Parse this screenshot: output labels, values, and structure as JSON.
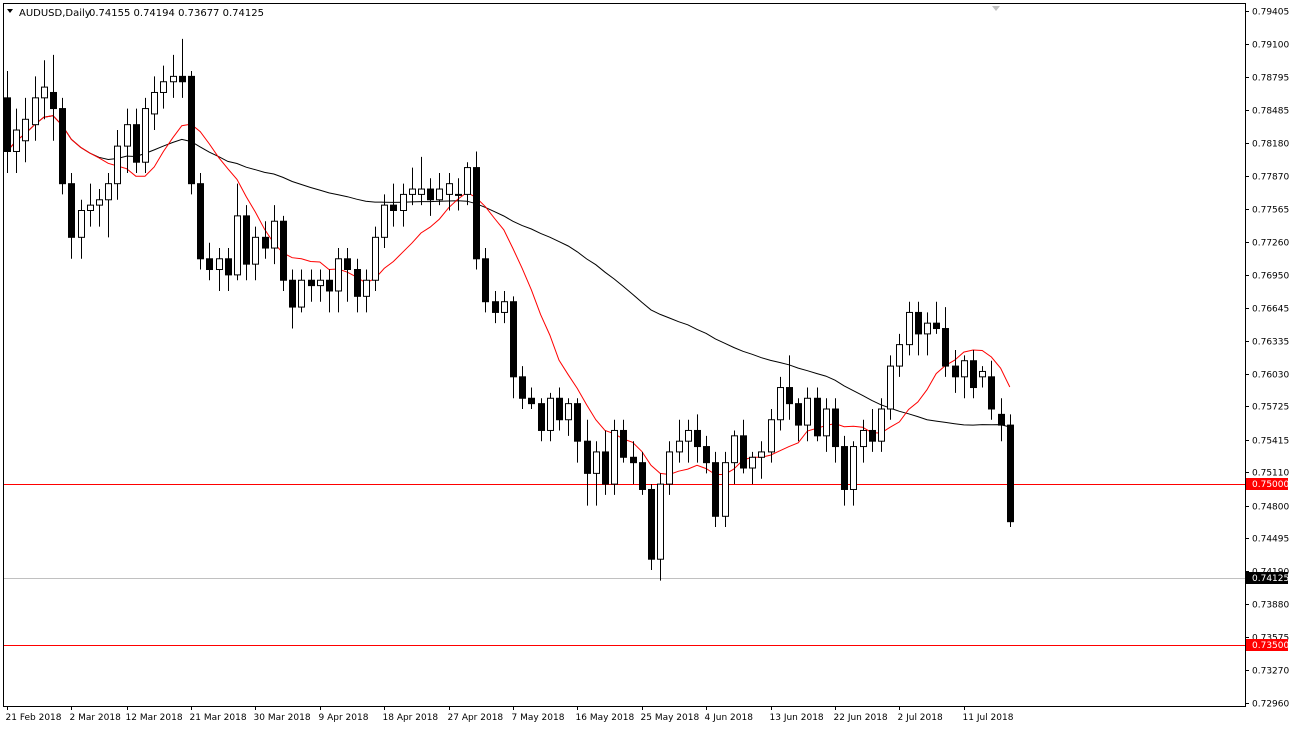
{
  "header": {
    "symbol": "AUDUSD,Daily",
    "ohlc": "0.74155 0.74194 0.73677 0.74125"
  },
  "chart_data": {
    "type": "candlestick",
    "symbol": "AUDUSD",
    "timeframe": "Daily",
    "ylim": [
      0.7296,
      0.794
    ],
    "y_ticks": [
      "0.79405",
      "0.79100",
      "0.78795",
      "0.78485",
      "0.78180",
      "0.77870",
      "0.77565",
      "0.77260",
      "0.76950",
      "0.76645",
      "0.76335",
      "0.76030",
      "0.75725",
      "0.75415",
      "0.75110",
      "0.74800",
      "0.74495",
      "0.74190",
      "0.73880",
      "0.73575",
      "0.73270",
      "0.72960"
    ],
    "x_ticks": [
      {
        "label": "21 Feb 2018",
        "index": 0
      },
      {
        "label": "2 Mar 2018",
        "index": 7
      },
      {
        "label": "12 Mar 2018",
        "index": 13
      },
      {
        "label": "21 Mar 2018",
        "index": 20
      },
      {
        "label": "30 Mar 2018",
        "index": 27
      },
      {
        "label": "9 Apr 2018",
        "index": 34
      },
      {
        "label": "18 Apr 2018",
        "index": 41
      },
      {
        "label": "27 Apr 2018",
        "index": 48
      },
      {
        "label": "7 May 2018",
        "index": 55
      },
      {
        "label": "16 May 2018",
        "index": 62
      },
      {
        "label": "25 May 2018",
        "index": 69
      },
      {
        "label": "4 Jun 2018",
        "index": 76
      },
      {
        "label": "13 Jun 2018",
        "index": 83
      },
      {
        "label": "22 Jun 2018",
        "index": 90
      },
      {
        "label": "2 Jul 2018",
        "index": 97
      },
      {
        "label": "11 Jul 2018",
        "index": 104
      }
    ],
    "candles": [
      [
        0.786,
        0.7885,
        0.779,
        0.781
      ],
      [
        0.781,
        0.785,
        0.779,
        0.783
      ],
      [
        0.782,
        0.786,
        0.78,
        0.784
      ],
      [
        0.7835,
        0.788,
        0.782,
        0.786
      ],
      [
        0.786,
        0.7895,
        0.784,
        0.787
      ],
      [
        0.7865,
        0.79,
        0.782,
        0.785
      ],
      [
        0.785,
        0.786,
        0.777,
        0.778
      ],
      [
        0.778,
        0.779,
        0.771,
        0.773
      ],
      [
        0.773,
        0.7765,
        0.771,
        0.7755
      ],
      [
        0.7755,
        0.778,
        0.774,
        0.776
      ],
      [
        0.776,
        0.7775,
        0.774,
        0.7765
      ],
      [
        0.7765,
        0.779,
        0.773,
        0.778
      ],
      [
        0.778,
        0.783,
        0.7765,
        0.7815
      ],
      [
        0.7815,
        0.785,
        0.779,
        0.7835
      ],
      [
        0.7835,
        0.785,
        0.779,
        0.78
      ],
      [
        0.78,
        0.786,
        0.779,
        0.785
      ],
      [
        0.7845,
        0.788,
        0.783,
        0.7865
      ],
      [
        0.7865,
        0.789,
        0.785,
        0.7875
      ],
      [
        0.7875,
        0.79,
        0.786,
        0.788
      ],
      [
        0.788,
        0.7915,
        0.786,
        0.7875
      ],
      [
        0.788,
        0.7885,
        0.777,
        0.778
      ],
      [
        0.778,
        0.779,
        0.77,
        0.771
      ],
      [
        0.771,
        0.7725,
        0.769,
        0.77
      ],
      [
        0.77,
        0.772,
        0.768,
        0.771
      ],
      [
        0.771,
        0.772,
        0.768,
        0.7695
      ],
      [
        0.7695,
        0.778,
        0.769,
        0.775
      ],
      [
        0.775,
        0.776,
        0.769,
        0.7705
      ],
      [
        0.7705,
        0.774,
        0.769,
        0.773
      ],
      [
        0.773,
        0.7745,
        0.771,
        0.772
      ],
      [
        0.772,
        0.776,
        0.7705,
        0.7745
      ],
      [
        0.7745,
        0.775,
        0.768,
        0.769
      ],
      [
        0.769,
        0.77,
        0.7645,
        0.7665
      ],
      [
        0.7665,
        0.77,
        0.766,
        0.769
      ],
      [
        0.769,
        0.77,
        0.767,
        0.7685
      ],
      [
        0.7685,
        0.77,
        0.767,
        0.769
      ],
      [
        0.769,
        0.77,
        0.766,
        0.768
      ],
      [
        0.768,
        0.772,
        0.766,
        0.771
      ],
      [
        0.771,
        0.772,
        0.767,
        0.77
      ],
      [
        0.77,
        0.771,
        0.766,
        0.7675
      ],
      [
        0.7675,
        0.77,
        0.766,
        0.769
      ],
      [
        0.769,
        0.774,
        0.768,
        0.773
      ],
      [
        0.773,
        0.777,
        0.772,
        0.776
      ],
      [
        0.776,
        0.778,
        0.774,
        0.7755
      ],
      [
        0.7755,
        0.778,
        0.774,
        0.777
      ],
      [
        0.777,
        0.7795,
        0.776,
        0.7775
      ],
      [
        0.777,
        0.7805,
        0.776,
        0.7775
      ],
      [
        0.7775,
        0.7785,
        0.775,
        0.7765
      ],
      [
        0.7765,
        0.779,
        0.776,
        0.7775
      ],
      [
        0.777,
        0.779,
        0.7755,
        0.778
      ],
      [
        0.777,
        0.7785,
        0.7755,
        0.777
      ],
      [
        0.777,
        0.78,
        0.776,
        0.7795
      ],
      [
        0.7795,
        0.781,
        0.77,
        0.771
      ],
      [
        0.771,
        0.772,
        0.766,
        0.767
      ],
      [
        0.767,
        0.768,
        0.765,
        0.766
      ],
      [
        0.766,
        0.768,
        0.765,
        0.767
      ],
      [
        0.767,
        0.7675,
        0.758,
        0.76
      ],
      [
        0.76,
        0.761,
        0.757,
        0.758
      ],
      [
        0.758,
        0.759,
        0.757,
        0.7575
      ],
      [
        0.7575,
        0.758,
        0.754,
        0.755
      ],
      [
        0.755,
        0.7585,
        0.754,
        0.758
      ],
      [
        0.758,
        0.759,
        0.755,
        0.756
      ],
      [
        0.756,
        0.758,
        0.7545,
        0.7575
      ],
      [
        0.7575,
        0.758,
        0.752,
        0.754
      ],
      [
        0.754,
        0.756,
        0.748,
        0.751
      ],
      [
        0.751,
        0.754,
        0.748,
        0.753
      ],
      [
        0.753,
        0.755,
        0.749,
        0.75
      ],
      [
        0.75,
        0.756,
        0.749,
        0.755
      ],
      [
        0.755,
        0.756,
        0.752,
        0.7525
      ],
      [
        0.7525,
        0.754,
        0.75,
        0.752
      ],
      [
        0.752,
        0.753,
        0.749,
        0.7495
      ],
      [
        0.7495,
        0.75,
        0.742,
        0.743
      ],
      [
        0.743,
        0.751,
        0.741,
        0.75
      ],
      [
        0.75,
        0.754,
        0.749,
        0.753
      ],
      [
        0.753,
        0.756,
        0.752,
        0.754
      ],
      [
        0.754,
        0.756,
        0.752,
        0.755
      ],
      [
        0.755,
        0.7565,
        0.752,
        0.7535
      ],
      [
        0.7535,
        0.7545,
        0.751,
        0.752
      ],
      [
        0.752,
        0.753,
        0.746,
        0.747
      ],
      [
        0.747,
        0.753,
        0.746,
        0.752
      ],
      [
        0.752,
        0.755,
        0.75,
        0.7545
      ],
      [
        0.7545,
        0.756,
        0.751,
        0.7515
      ],
      [
        0.7515,
        0.753,
        0.75,
        0.7525
      ],
      [
        0.7525,
        0.754,
        0.7505,
        0.753
      ],
      [
        0.753,
        0.757,
        0.752,
        0.756
      ],
      [
        0.756,
        0.76,
        0.755,
        0.759
      ],
      [
        0.759,
        0.762,
        0.756,
        0.7575
      ],
      [
        0.7575,
        0.758,
        0.754,
        0.7555
      ],
      [
        0.7555,
        0.759,
        0.754,
        0.758
      ],
      [
        0.758,
        0.759,
        0.754,
        0.7545
      ],
      [
        0.7545,
        0.758,
        0.753,
        0.757
      ],
      [
        0.757,
        0.758,
        0.752,
        0.7535
      ],
      [
        0.7535,
        0.7545,
        0.748,
        0.7495
      ],
      [
        0.7495,
        0.754,
        0.748,
        0.7535
      ],
      [
        0.7535,
        0.756,
        0.752,
        0.755
      ],
      [
        0.755,
        0.757,
        0.753,
        0.754
      ],
      [
        0.754,
        0.758,
        0.753,
        0.757
      ],
      [
        0.757,
        0.762,
        0.756,
        0.761
      ],
      [
        0.761,
        0.764,
        0.76,
        0.763
      ],
      [
        0.763,
        0.767,
        0.762,
        0.766
      ],
      [
        0.766,
        0.767,
        0.762,
        0.764
      ],
      [
        0.764,
        0.766,
        0.762,
        0.765
      ],
      [
        0.765,
        0.767,
        0.764,
        0.7645
      ],
      [
        0.7645,
        0.7665,
        0.76,
        0.761
      ],
      [
        0.761,
        0.7625,
        0.7585,
        0.76
      ],
      [
        0.76,
        0.762,
        0.758,
        0.7615
      ],
      [
        0.7615,
        0.7625,
        0.758,
        0.759
      ],
      [
        0.76,
        0.761,
        0.759,
        0.7605
      ],
      [
        0.76,
        0.7615,
        0.756,
        0.757
      ],
      [
        0.7565,
        0.758,
        0.754,
        0.7555
      ],
      [
        0.7555,
        0.7565,
        0.746,
        0.7465
      ]
    ],
    "horizontal_lines": [
      {
        "label": "0.75000",
        "value": 0.75,
        "color": "#ff0000"
      },
      {
        "label": "0.73500",
        "value": 0.735,
        "color": "#ff0000"
      }
    ],
    "current_price": {
      "label": "0.74125",
      "value": 0.74125,
      "color": "#c0c0c0"
    },
    "ma_fast_color": "#ff0000",
    "ma_slow_color": "#000000",
    "grid": false
  },
  "colors": {
    "bull_body": "#ffffff",
    "bear_body": "#000000",
    "wick": "#000000",
    "background": "#ffffff"
  }
}
